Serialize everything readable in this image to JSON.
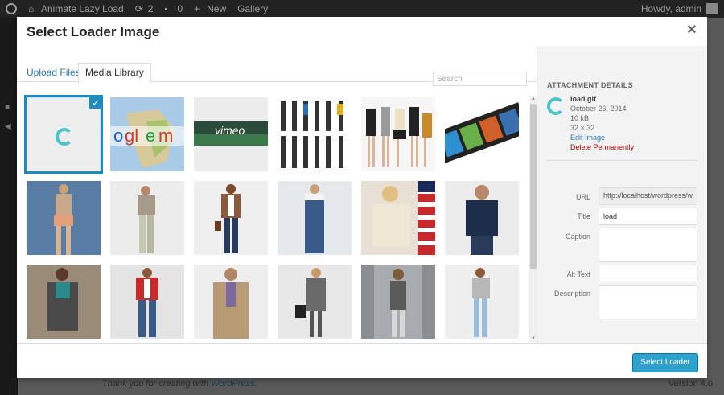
{
  "adminbar": {
    "site_name": "Animate Lazy Load",
    "updates_count": "2",
    "comments_count": "0",
    "new_label": "New",
    "gallery_label": "Gallery",
    "greeting": "Howdy, admin"
  },
  "footer": {
    "thanks_prefix": "Thank you for creating with ",
    "thanks_link": "WordPress",
    "thanks_suffix": ".",
    "version": "Version 4.0"
  },
  "modal": {
    "title": "Select Loader Image",
    "close_icon": "close-icon",
    "tabs": [
      {
        "label": "Upload Files",
        "active": false
      },
      {
        "label": "Media Library",
        "active": true
      }
    ],
    "search_placeholder": "Search",
    "button_label": "Select Loader"
  },
  "grid_items": [
    {
      "name": "loader-gif",
      "selected": true
    },
    {
      "name": "google-map"
    },
    {
      "name": "vimeo"
    },
    {
      "name": "fashion-grid"
    },
    {
      "name": "models-group"
    },
    {
      "name": "film-strip"
    },
    {
      "name": "woman-denim-shorts"
    },
    {
      "name": "woman-camo-pants"
    },
    {
      "name": "woman-brown-jacket"
    },
    {
      "name": "woman-overalls"
    },
    {
      "name": "woman-sweater-flag"
    },
    {
      "name": "man-navy-hoodie"
    },
    {
      "name": "woman-scarf-cardigan"
    },
    {
      "name": "man-red-hoodie"
    },
    {
      "name": "man-tan-blazer"
    },
    {
      "name": "woman-grey-coat"
    },
    {
      "name": "woman-city-street"
    },
    {
      "name": "woman-knit-top"
    }
  ],
  "attachment": {
    "heading": "ATTACHMENT DETAILS",
    "filename": "load.gif",
    "date": "October 26, 2014",
    "size": "10 kB",
    "dimensions": "32 × 32",
    "edit_label": "Edit Image",
    "delete_label": "Delete Permanently",
    "fields": {
      "url_label": "URL",
      "url_value": "http://localhost/wordpress/w",
      "title_label": "Title",
      "title_value": "load",
      "caption_label": "Caption",
      "alt_label": "Alt Text",
      "description_label": "Description"
    }
  },
  "colors": {
    "accent": "#1e8cbe",
    "primary_button": "#2ea2cc",
    "delete": "#aa0000",
    "loader": "#45c6cb"
  }
}
